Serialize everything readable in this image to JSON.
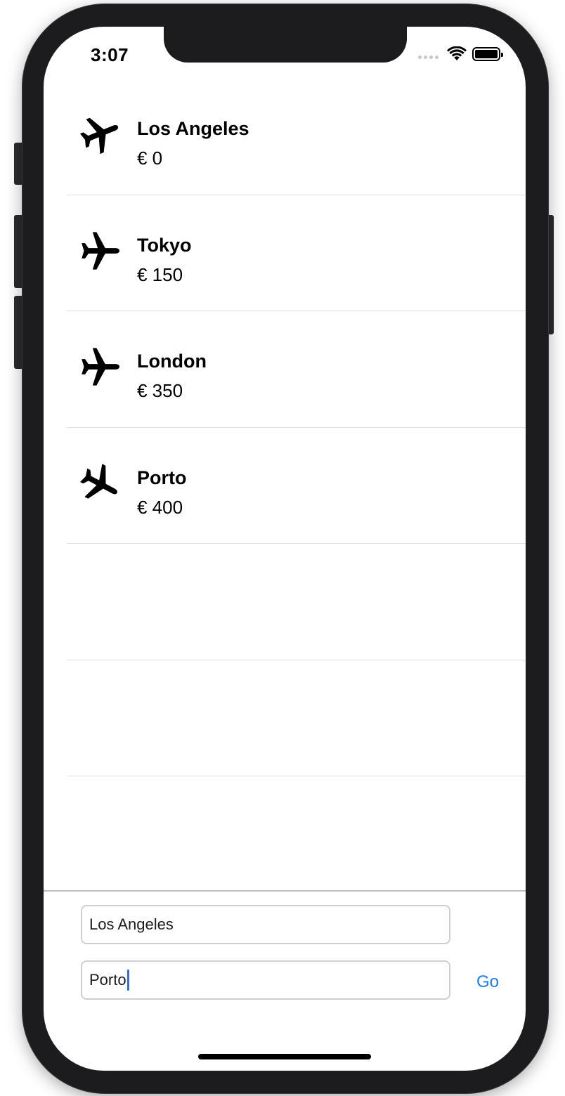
{
  "status_bar": {
    "time": "3:07"
  },
  "flights": [
    {
      "city": "Los Angeles",
      "price": "€ 0",
      "icon": "airplane-takeoff-icon"
    },
    {
      "city": "Tokyo",
      "price": "€ 150",
      "icon": "airplane-icon"
    },
    {
      "city": "London",
      "price": "€ 350",
      "icon": "airplane-icon"
    },
    {
      "city": "Porto",
      "price": "€ 400",
      "icon": "airplane-landing-icon"
    }
  ],
  "form": {
    "from_value": "Los Angeles",
    "to_value": "Porto",
    "go_label": "Go",
    "accent_color": "#1a7cf5"
  }
}
